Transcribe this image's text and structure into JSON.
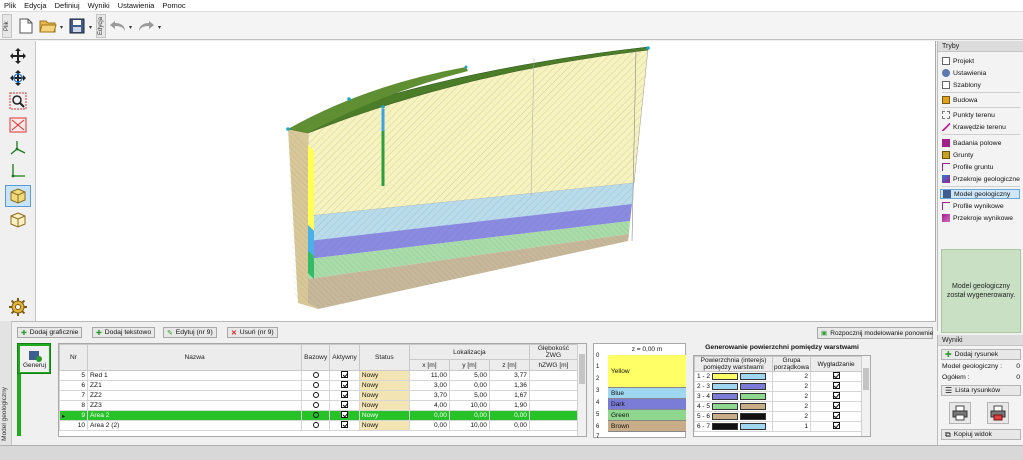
{
  "menu": [
    "Plik",
    "Edycja",
    "Definiuj",
    "Wyniki",
    "Ustawienia",
    "Pomoc"
  ],
  "toolbar": {
    "tab_file": "Plik",
    "tab_edit": "Edycja"
  },
  "right_panel": {
    "header": "Tryby",
    "items": [
      {
        "label": "Projekt",
        "icon": "document-icon"
      },
      {
        "label": "Ustawienia",
        "icon": "settings-icon"
      },
      {
        "label": "Szablony",
        "icon": "template-icon"
      },
      {
        "label": "Budowa",
        "icon": "building-icon"
      },
      {
        "label": "Punkty terenu",
        "icon": "terrain-points-icon"
      },
      {
        "label": "Krawędzie terenu",
        "icon": "terrain-edges-icon"
      },
      {
        "label": "Badania polowe",
        "icon": "field-tests-icon"
      },
      {
        "label": "Grunty",
        "icon": "soils-icon"
      },
      {
        "label": "Profile gruntu",
        "icon": "soil-profile-icon"
      },
      {
        "label": "Przekroje geologiczne",
        "icon": "geo-section-icon"
      },
      {
        "label": "Model geologiczny",
        "icon": "geo-model-icon"
      },
      {
        "label": "Profile wynikowe",
        "icon": "result-profile-icon"
      },
      {
        "label": "Przekroje wynikowe",
        "icon": "result-section-icon"
      }
    ],
    "message": "Model geologiczny został wygenerowany."
  },
  "results_panel": {
    "header": "Wyniki",
    "add_drawing": "Dodaj rysunek",
    "model_label": "Model geologiczny :",
    "model_count": "0",
    "total_label": "Ogółem :",
    "total_count": "0",
    "list_drawings": "Lista rysunków",
    "copy_view": "Kopiuj widok"
  },
  "bottom": {
    "side_tab": "Model geologiczny",
    "add_graphic": "Dodaj graficznie",
    "add_text": "Dodaj tekstowo",
    "edit": "Edytuj (nr 9)",
    "delete": "Usuń (nr 9)",
    "generate": "Generuj",
    "restart": "Rozpocznij modelowanie ponownie"
  },
  "points_table": {
    "headers": {
      "nr": "Nr",
      "name": "Nazwa",
      "base": "Bazowy",
      "active": "Aktywny",
      "status": "Status",
      "location": "Lokalizacja",
      "depth": "Głębokość ZWG",
      "x": "x [m]",
      "y": "y [m]",
      "z": "z [m]",
      "hzwg": "hZWG [m]"
    },
    "rows": [
      {
        "nr": "5",
        "name": "Red 1",
        "status": "Nowy",
        "x": "11,00",
        "y": "5,00",
        "z": "3,77",
        "selected": false
      },
      {
        "nr": "6",
        "name": "ZZ1",
        "status": "Nowy",
        "x": "3,00",
        "y": "0,00",
        "z": "1,36",
        "selected": false
      },
      {
        "nr": "7",
        "name": "ZZ2",
        "status": "Nowy",
        "x": "3,70",
        "y": "5,00",
        "z": "1,67",
        "selected": false
      },
      {
        "nr": "8",
        "name": "ZZ3",
        "status": "Nowy",
        "x": "4,00",
        "y": "10,00",
        "z": "1,90",
        "selected": false
      },
      {
        "nr": "9",
        "name": "Area 2",
        "status": "Nowy",
        "x": "0,00",
        "y": "0,00",
        "z": "0,00",
        "selected": true
      },
      {
        "nr": "10",
        "name": "Area 2 (2)",
        "status": "Nowy",
        "x": "0,00",
        "y": "10,00",
        "z": "0,00",
        "selected": false
      }
    ]
  },
  "legend": {
    "z_label": "z = 0,00 m",
    "layers": [
      {
        "name": "Yellow",
        "color": "#ffff66"
      },
      {
        "name": "Blue",
        "color": "#9fd6f0"
      },
      {
        "name": "Dark",
        "color": "#7b7bd8"
      },
      {
        "name": "Green",
        "color": "#8fd68f"
      },
      {
        "name": "Brown",
        "color": "#c9ad88"
      }
    ],
    "ruler": [
      "0",
      "1",
      "2",
      "3",
      "4",
      "5",
      "6",
      "7"
    ]
  },
  "surfaces": {
    "title": "Generowanie powierzchni pomiędzy warstwami",
    "headers": {
      "surface": "Powierzchnia (interejs) pomiędzy warstwami",
      "group": "Grupa porządkowa",
      "smoothing": "Wygładzanie"
    },
    "rows": [
      {
        "pair": "1 - 2",
        "c1": "#ffff66",
        "c2": "#9fd6f0",
        "group": "2"
      },
      {
        "pair": "2 - 3",
        "c1": "#9fd6f0",
        "c2": "#7b7bd8",
        "group": "2"
      },
      {
        "pair": "3 - 4",
        "c1": "#7b7bd8",
        "c2": "#8fd68f",
        "group": "2"
      },
      {
        "pair": "4 - 5",
        "c1": "#8fd68f",
        "c2": "#c9ad88",
        "group": "2"
      },
      {
        "pair": "5 - 6",
        "c1": "#c9ad88",
        "c2": "#111111",
        "group": "2"
      },
      {
        "pair": "6 - 7",
        "c1": "#111111",
        "c2": "#9fd6f0",
        "group": "1"
      }
    ]
  }
}
